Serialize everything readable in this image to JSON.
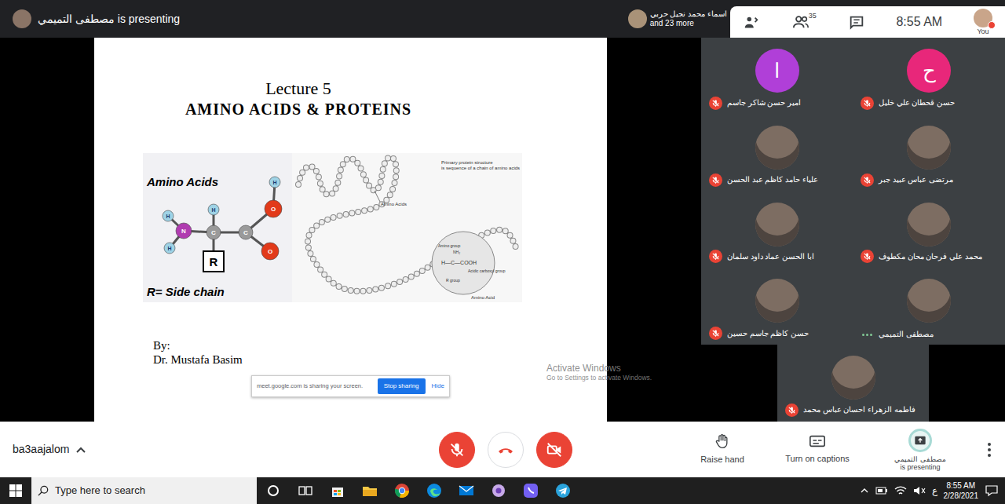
{
  "top_bar": {
    "presenting": "مصطفى التميمي is presenting",
    "others_name": "اسماء محمد نجيل حربي",
    "others_more": "and 23 more"
  },
  "meeting_panel": {
    "people_count": "35",
    "clock": "8:55 AM",
    "self_label": "You"
  },
  "slide": {
    "lecture": "Lecture 5",
    "title": "AMINO ACIDS & PROTEINS",
    "diagram": {
      "heading": "Amino Acids",
      "atoms": [
        {
          "symbol": "H",
          "color": "#9fd3e6"
        },
        {
          "symbol": "N",
          "color": "#b03cb0"
        },
        {
          "symbol": "H",
          "color": "#9fd3e6"
        },
        {
          "symbol": "H",
          "color": "#9fd3e6"
        },
        {
          "symbol": "C",
          "color": "#9a9a9a"
        },
        {
          "symbol": "C",
          "color": "#9a9a9a"
        },
        {
          "symbol": "H",
          "color": "#9fd3e6"
        },
        {
          "symbol": "O",
          "color": "#e23a1a"
        },
        {
          "symbol": "O",
          "color": "#e23a1a"
        }
      ],
      "side_chain": "R",
      "caption": "R= Side chain"
    },
    "protein": {
      "caption_lines": [
        "Primary protein structure",
        "is sequence of a chain of amino acids"
      ],
      "chain_label": "Amino Acids",
      "zoom_labels": [
        "Amino group",
        "NH₂",
        "H—C—COOH",
        "Acidic carboxyl group",
        "R group"
      ],
      "zoom_caption": "Amino Acid"
    },
    "author_prefix": "By:",
    "author": "Dr. Mustafa Basim"
  },
  "sharing_bar": {
    "message": "meet.google.com is sharing your screen.",
    "stop": "Stop sharing",
    "hide": "Hide"
  },
  "watermark": {
    "title": "Activate Windows",
    "subtitle": "Go to Settings to activate Windows."
  },
  "participants": [
    {
      "name": "امير حسن شاكر جاسم",
      "muted": true,
      "speaking": false,
      "kind": "letter",
      "letter": "ا",
      "color": "#b03fd8"
    },
    {
      "name": "حسن قحطان علي خليل",
      "muted": true,
      "speaking": false,
      "kind": "letter",
      "letter": "ح",
      "color": "#e8277a"
    },
    {
      "name": "علياء حامد كاظم عبد الحسن",
      "muted": true,
      "speaking": false,
      "kind": "photo"
    },
    {
      "name": "مرتضى عباس عبيد جبر",
      "muted": true,
      "speaking": false,
      "kind": "photo"
    },
    {
      "name": "ابا الحسن عماد داود سلمان",
      "muted": true,
      "speaking": false,
      "kind": "photo"
    },
    {
      "name": "محمد علي فرحان محان مكطوف",
      "muted": true,
      "speaking": false,
      "kind": "photo"
    },
    {
      "name": "حسن كاظم جاسم حسين",
      "muted": true,
      "speaking": false,
      "kind": "photo"
    },
    {
      "name": "مصطفى التميمي",
      "muted": false,
      "speaking": true,
      "kind": "photo"
    },
    {
      "name": "فاطمه الزهراء احسان عباس محمد",
      "muted": true,
      "speaking": false,
      "kind": "photo"
    }
  ],
  "controls": {
    "account": "ba3aajalom",
    "mic_muted": true,
    "camera_off": true,
    "actions": [
      {
        "label": "Raise hand"
      },
      {
        "label": "Turn on captions"
      }
    ],
    "presenting_name": "مصطفى التميمي",
    "presenting_label": "is presenting"
  },
  "taskbar": {
    "search_placeholder": "Type here to search",
    "language": "ع",
    "time": "8:55 AM",
    "date": "2/28/2021"
  }
}
